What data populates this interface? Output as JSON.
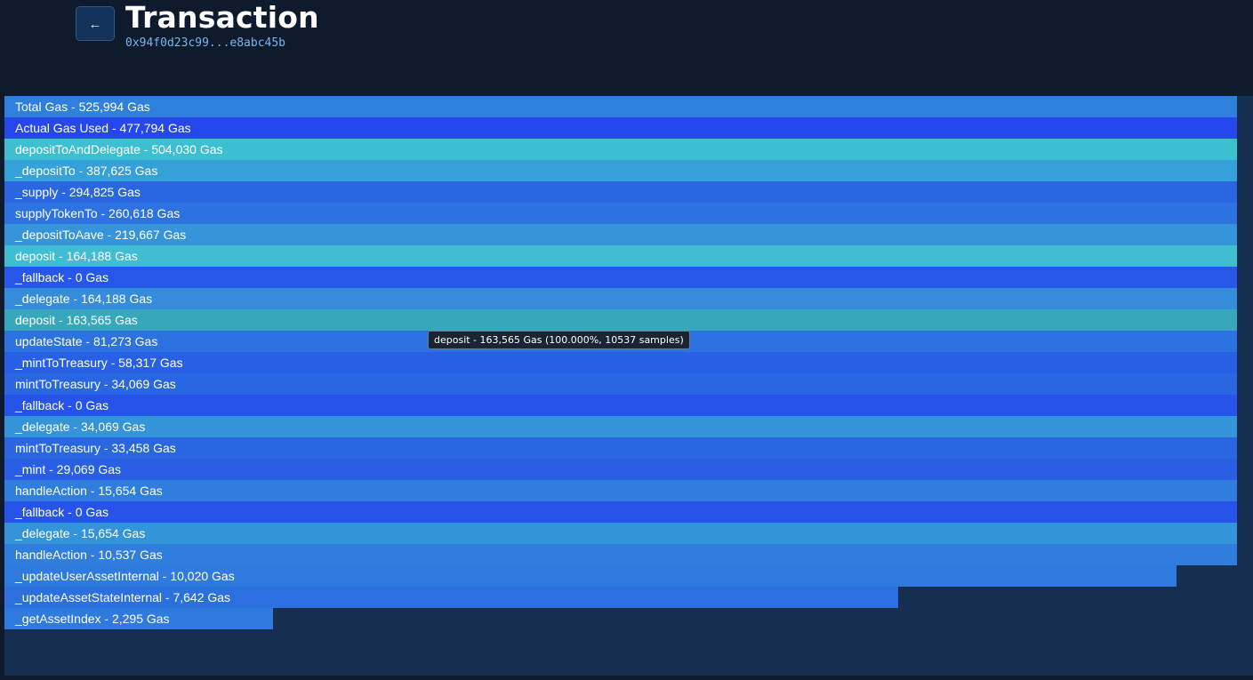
{
  "header": {
    "back_icon": "arrow-left-icon",
    "back_glyph": "←",
    "title": "Transaction",
    "tx_hash": "0x94f0d23c99...e8abc45b"
  },
  "flamegraph": {
    "total_gas": 525994,
    "rows": [
      {
        "label": "Total Gas - 525,994 Gas",
        "fraction": 1.0,
        "color": "#2f7fdc"
      },
      {
        "label": "Actual Gas Used - 477,794 Gas",
        "fraction": 1.0,
        "color": "#2548ed"
      },
      {
        "label": "depositToAndDelegate - 504,030 Gas",
        "fraction": 1.0,
        "color": "#3dbfd2"
      },
      {
        "label": "_depositTo - 387,625 Gas",
        "fraction": 1.0,
        "color": "#35a1d9"
      },
      {
        "label": "_supply - 294,825 Gas",
        "fraction": 1.0,
        "color": "#2866e2"
      },
      {
        "label": "supplyTokenTo - 260,618 Gas",
        "fraction": 1.0,
        "color": "#2c72e0"
      },
      {
        "label": "_depositToAave - 219,667 Gas",
        "fraction": 1.0,
        "color": "#3694da"
      },
      {
        "label": "deposit - 164,188 Gas",
        "fraction": 1.0,
        "color": "#3fbdd3"
      },
      {
        "label": "_fallback - 0 Gas",
        "fraction": 1.0,
        "color": "#2757e8"
      },
      {
        "label": "_delegate - 164,188 Gas",
        "fraction": 1.0,
        "color": "#348cdb"
      },
      {
        "label": "deposit - 163,565 Gas",
        "fraction": 1.0,
        "color": "#37a7bd"
      },
      {
        "label": "updateState - 81,273 Gas",
        "fraction": 1.0,
        "color": "#2c72e0"
      },
      {
        "label": "_mintToTreasury - 58,317 Gas",
        "fraction": 1.0,
        "color": "#2760e5"
      },
      {
        "label": "mintToTreasury - 34,069 Gas",
        "fraction": 1.0,
        "color": "#2866e2"
      },
      {
        "label": "_fallback - 0 Gas",
        "fraction": 1.0,
        "color": "#2653ea"
      },
      {
        "label": "_delegate - 34,069 Gas",
        "fraction": 1.0,
        "color": "#3494da"
      },
      {
        "label": "mintToTreasury - 33,458 Gas",
        "fraction": 1.0,
        "color": "#2866e2"
      },
      {
        "label": "_mint - 29,069 Gas",
        "fraction": 1.0,
        "color": "#285fe4"
      },
      {
        "label": "handleAction - 15,654 Gas",
        "fraction": 1.0,
        "color": "#2f7ede"
      },
      {
        "label": "_fallback - 0 Gas",
        "fraction": 1.0,
        "color": "#2653ea"
      },
      {
        "label": "_delegate - 15,654 Gas",
        "fraction": 1.0,
        "color": "#3494da"
      },
      {
        "label": "handleAction - 10,537 Gas",
        "fraction": 1.0,
        "color": "#2f7ede"
      },
      {
        "label": "_updateUserAssetInternal - 10,020 Gas",
        "fraction": 0.951,
        "color": "#2f7ade"
      },
      {
        "label": "_updateAssetStateInternal - 7,642 Gas",
        "fraction": 0.725,
        "color": "#2c70e0"
      },
      {
        "label": "_getAssetIndex - 2,295 Gas",
        "fraction": 0.218,
        "color": "#2f7ade"
      }
    ]
  },
  "tooltip": {
    "text": "deposit - 163,565 Gas (100.000%, 10537 samples)"
  }
}
